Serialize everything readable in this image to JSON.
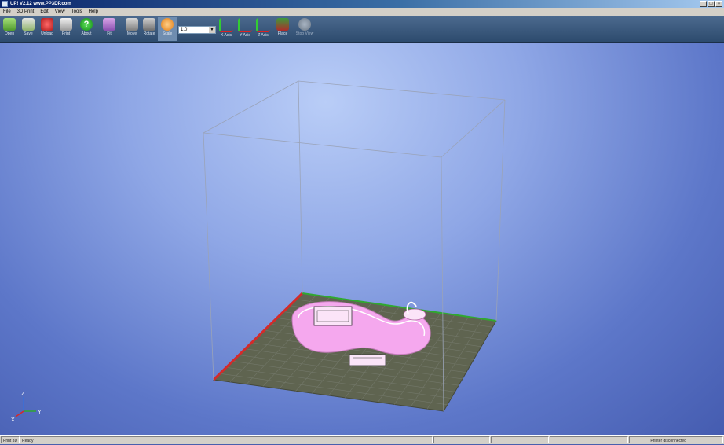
{
  "window": {
    "title": "UP! V2.12 www.PP3DP.com",
    "buttons": [
      "_",
      "□",
      "×"
    ]
  },
  "menu": [
    "File",
    "3D Print",
    "Edit",
    "View",
    "Tools",
    "Help"
  ],
  "toolbar": {
    "open": "Open",
    "save": "Save",
    "unload": "Unload",
    "print": "Print",
    "about": "About",
    "fit": "Fit",
    "move": "Move",
    "rotate": "Rotate",
    "scale": "Scale",
    "x_axis": "X Axis",
    "y_axis": "Y Axis",
    "z_axis": "Z Axis",
    "place": "Place",
    "stop_view": "Stop View",
    "scale_value": "1.0"
  },
  "viewport": {
    "axis_labels": {
      "x": "X",
      "y": "Y",
      "z": "Z"
    }
  },
  "status": {
    "left": "Print 3D",
    "message": "Ready",
    "connection": "Printer disconnected"
  },
  "colors": {
    "model": "#f5a8ee",
    "platform": "#5f6450",
    "x_edge": "#d42a2a",
    "y_edge": "#30a830",
    "accent": "#3a6ea5"
  }
}
